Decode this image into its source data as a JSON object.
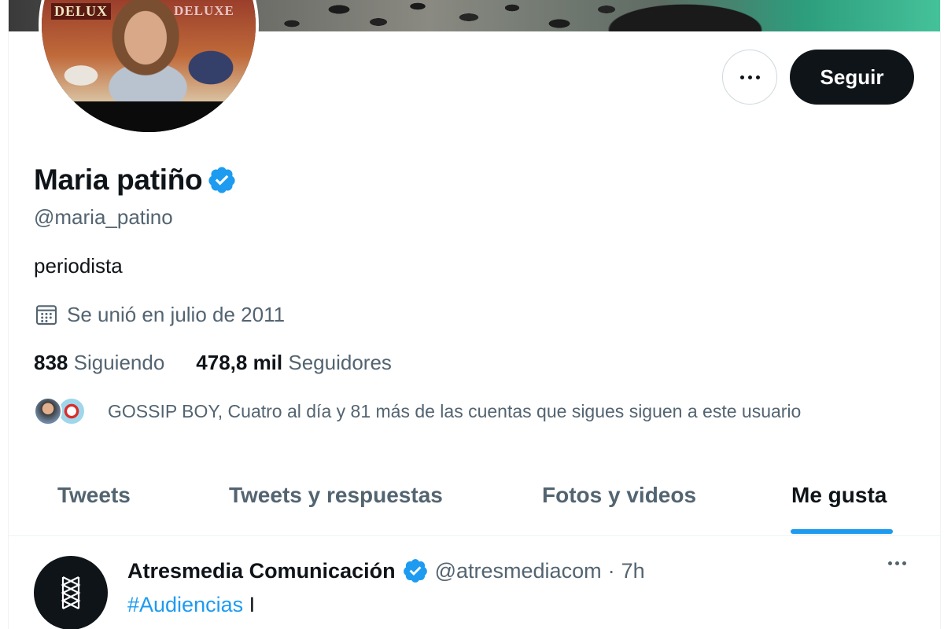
{
  "profile": {
    "avatar_sign_left": "DELUX",
    "avatar_sign_right": "DELUXE",
    "name": "Maria patiño",
    "handle": "@maria_patino",
    "bio": "periodista",
    "joined": "Se unió en julio de 2011",
    "following_count": "838",
    "following_label": "Siguiendo",
    "followers_count": "478,8 mil",
    "followers_label": "Seguidores",
    "known_followers": "GOSSIP BOY, Cuatro al día y 81 más de las cuentas que sigues siguen a este usuario",
    "verified": true
  },
  "actions": {
    "more_icon": "more-horizontal-icon",
    "follow_label": "Seguir"
  },
  "tabs": [
    {
      "label": "Tweets",
      "active": false
    },
    {
      "label": "Tweets y respuestas",
      "active": false
    },
    {
      "label": "Fotos y videos",
      "active": false
    },
    {
      "label": "Me gusta",
      "active": true
    }
  ],
  "tweet": {
    "author_name": "Atresmedia Comunicación",
    "author_handle": "@atresmediacom",
    "separator": "·",
    "time": "7h",
    "hashtag": "#Audiencias",
    "text_rest": " I"
  },
  "colors": {
    "accent": "#1d9bf0",
    "text_primary": "#0f1419",
    "text_secondary": "#536471",
    "follow_button": "#0f1419"
  }
}
